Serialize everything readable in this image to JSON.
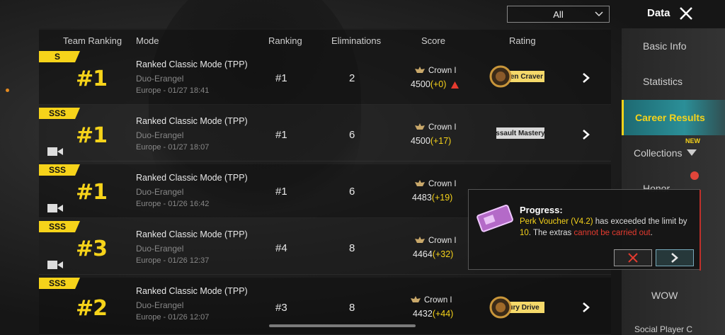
{
  "filter": {
    "selected": "All"
  },
  "header": {
    "title": "Data"
  },
  "columns": [
    "Team Ranking",
    "Mode",
    "Ranking",
    "Eliminations",
    "Score",
    "Rating"
  ],
  "rows": [
    {
      "tier": "S",
      "team_rank": "#1",
      "mode": "Ranked Classic Mode (TPP)",
      "map": "Duo-Erangel",
      "date": "Europe - 01/27 18:41",
      "ranking": "#1",
      "eliminations": "2",
      "crown": "Crown I",
      "score": "4500",
      "delta": "(+0)",
      "rating": "icken Craver",
      "has_video": false
    },
    {
      "tier": "SSS",
      "team_rank": "#1",
      "mode": "Ranked Classic Mode (TPP)",
      "map": "Duo-Erangel",
      "date": "Europe - 01/27 18:07",
      "ranking": "#1",
      "eliminations": "6",
      "crown": "Crown I",
      "score": "4500",
      "delta": "(+17)",
      "rating": "ssault Mastery",
      "has_video": true
    },
    {
      "tier": "SSS",
      "team_rank": "#1",
      "mode": "Ranked Classic Mode (TPP)",
      "map": "Duo-Erangel",
      "date": "Europe - 01/26 16:42",
      "ranking": "#1",
      "eliminations": "6",
      "crown": "Crown I",
      "score": "4483",
      "delta": "(+19)",
      "rating": "",
      "has_video": true
    },
    {
      "tier": "SSS",
      "team_rank": "#3",
      "mode": "Ranked Classic Mode (TPP)",
      "map": "Duo-Erangel",
      "date": "Europe - 01/26 12:37",
      "ranking": "#4",
      "eliminations": "8",
      "crown": "Crown I",
      "score": "4464",
      "delta": "(+32)",
      "rating": "",
      "has_video": true
    },
    {
      "tier": "SSS",
      "team_rank": "#2",
      "mode": "Ranked Classic Mode (TPP)",
      "map": "Duo-Erangel",
      "date": "Europe - 01/26 12:07",
      "ranking": "#3",
      "eliminations": "8",
      "crown": "Crown I",
      "score": "4432",
      "delta": "(+44)",
      "rating": "Fury Drive",
      "has_video": false
    }
  ],
  "sidebar": {
    "items": [
      {
        "label": "Basic Info"
      },
      {
        "label": "Statistics"
      },
      {
        "label": "Career Results"
      },
      {
        "label": "Collections"
      },
      {
        "label": "Honor"
      },
      {
        "label": "WOW"
      },
      {
        "label": "Social Player C"
      }
    ],
    "new_badge": "NEW"
  },
  "popup": {
    "title": "Progress:",
    "item_name": "Perk Voucher (V4.2)",
    "text_mid": " has exceeded the limit by ",
    "limit": "10",
    "text_mid2": ". The extras ",
    "warning": "cannot be carried out",
    "text_end": "."
  },
  "colors": {
    "accent": "#f6d31a",
    "active_tab": "#2b8f98",
    "warning": "#e53b2f"
  }
}
